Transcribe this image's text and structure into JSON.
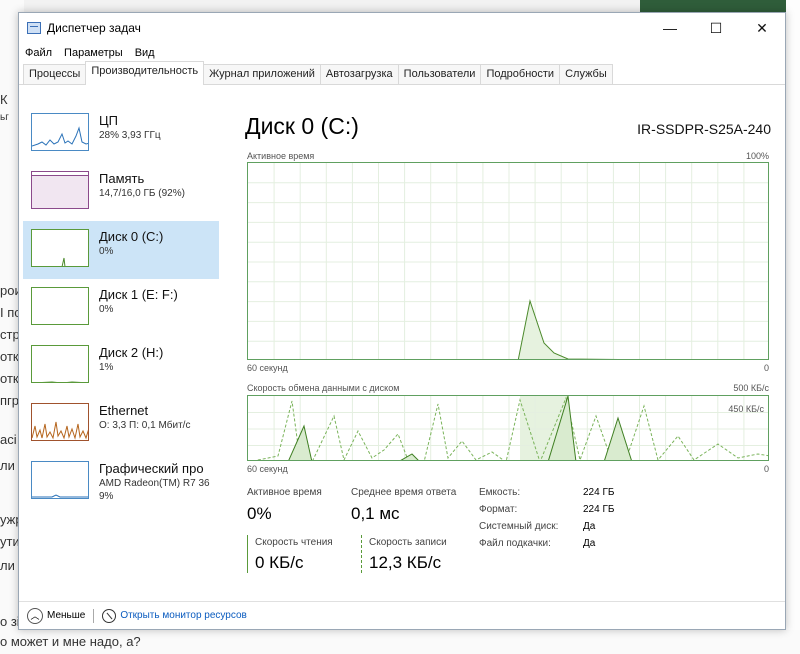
{
  "window": {
    "title": "Диспетчер задач",
    "controls": {
      "minimize": "—",
      "maximize": "☐",
      "close": "✕"
    }
  },
  "menu": [
    "Файл",
    "Параметры",
    "Вид"
  ],
  "tabs": [
    {
      "label": "Процессы",
      "active": false
    },
    {
      "label": "Производительность",
      "active": true
    },
    {
      "label": "Журнал приложений",
      "active": false
    },
    {
      "label": "Автозагрузка",
      "active": false
    },
    {
      "label": "Пользователи",
      "active": false
    },
    {
      "label": "Подробности",
      "active": false
    },
    {
      "label": "Службы",
      "active": false
    }
  ],
  "sidebar": {
    "items": [
      {
        "title": "ЦП",
        "sub1": "28% 3,93 ГГц",
        "sub2": ""
      },
      {
        "title": "Память",
        "sub1": "14,7/16,0 ГБ (92%)",
        "sub2": ""
      },
      {
        "title": "Диск 0 (C:)",
        "sub1": "0%",
        "sub2": ""
      },
      {
        "title": "Диск 1 (E: F:)",
        "sub1": "0%",
        "sub2": ""
      },
      {
        "title": "Диск 2 (H:)",
        "sub1": "1%",
        "sub2": ""
      },
      {
        "title": "Ethernet",
        "sub1": "О: 3,3 П: 0,1 Мбит/с",
        "sub2": ""
      },
      {
        "title": "Графический про",
        "sub1": "AMD Radeon(TM) R7 36",
        "sub2": "9%"
      }
    ]
  },
  "main": {
    "disk_title": "Диск 0 (C:)",
    "model": "IR-SSDPR-S25A-240",
    "chart1": {
      "label_left": "Активное время",
      "label_right": "100%",
      "bottom_left": "60 секунд",
      "bottom_right": "0"
    },
    "chart2": {
      "label_left": "Скорость обмена данными с диском",
      "label_right": "500 КБ/с",
      "inner_label": "450 КБ/с",
      "bottom_left": "60 секунд",
      "bottom_right": "0"
    },
    "stats": {
      "active_time_label": "Активное время",
      "active_time_value": "0%",
      "response_label": "Среднее время ответа",
      "response_value": "0,1 мс",
      "read_label": "Скорость чтения",
      "read_value": "0 КБ/с",
      "write_label": "Скорость записи",
      "write_value": "12,3 КБ/с"
    },
    "props": [
      {
        "label": "Емкость:",
        "value": "224 ГБ"
      },
      {
        "label": "Формат:",
        "value": "224 ГБ"
      },
      {
        "label": "Системный диск:",
        "value": "Да"
      },
      {
        "label": "Файл подкачки:",
        "value": "Да"
      }
    ]
  },
  "footer": {
    "less": "Меньше",
    "monitor": "Открыть монитор ресурсов"
  },
  "background": {
    "left_frags": [
      "К",
      "ьг",
      "рои",
      "I пс",
      "стр",
      "отка",
      "отк",
      "пгр",
      "асі",
      "ли",
      "ужр",
      "ути",
      "ли",
      "о зі"
    ],
    "bottom_text": "о может и мне надо, а?"
  }
}
